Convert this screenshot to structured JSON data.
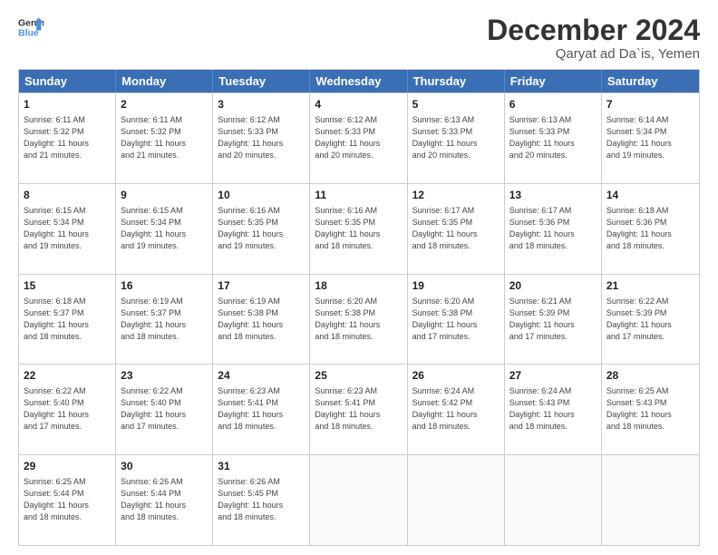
{
  "logo": {
    "line1": "General",
    "line2": "Blue"
  },
  "title": "December 2024",
  "location": "Qaryat ad Da`is, Yemen",
  "days_of_week": [
    "Sunday",
    "Monday",
    "Tuesday",
    "Wednesday",
    "Thursday",
    "Friday",
    "Saturday"
  ],
  "weeks": [
    [
      {
        "day": "1",
        "lines": [
          "Sunrise: 6:11 AM",
          "Sunset: 5:32 PM",
          "Daylight: 11 hours",
          "and 21 minutes."
        ]
      },
      {
        "day": "2",
        "lines": [
          "Sunrise: 6:11 AM",
          "Sunset: 5:32 PM",
          "Daylight: 11 hours",
          "and 21 minutes."
        ]
      },
      {
        "day": "3",
        "lines": [
          "Sunrise: 6:12 AM",
          "Sunset: 5:33 PM",
          "Daylight: 11 hours",
          "and 20 minutes."
        ]
      },
      {
        "day": "4",
        "lines": [
          "Sunrise: 6:12 AM",
          "Sunset: 5:33 PM",
          "Daylight: 11 hours",
          "and 20 minutes."
        ]
      },
      {
        "day": "5",
        "lines": [
          "Sunrise: 6:13 AM",
          "Sunset: 5:33 PM",
          "Daylight: 11 hours",
          "and 20 minutes."
        ]
      },
      {
        "day": "6",
        "lines": [
          "Sunrise: 6:13 AM",
          "Sunset: 5:33 PM",
          "Daylight: 11 hours",
          "and 20 minutes."
        ]
      },
      {
        "day": "7",
        "lines": [
          "Sunrise: 6:14 AM",
          "Sunset: 5:34 PM",
          "Daylight: 11 hours",
          "and 19 minutes."
        ]
      }
    ],
    [
      {
        "day": "8",
        "lines": [
          "Sunrise: 6:15 AM",
          "Sunset: 5:34 PM",
          "Daylight: 11 hours",
          "and 19 minutes."
        ]
      },
      {
        "day": "9",
        "lines": [
          "Sunrise: 6:15 AM",
          "Sunset: 5:34 PM",
          "Daylight: 11 hours",
          "and 19 minutes."
        ]
      },
      {
        "day": "10",
        "lines": [
          "Sunrise: 6:16 AM",
          "Sunset: 5:35 PM",
          "Daylight: 11 hours",
          "and 19 minutes."
        ]
      },
      {
        "day": "11",
        "lines": [
          "Sunrise: 6:16 AM",
          "Sunset: 5:35 PM",
          "Daylight: 11 hours",
          "and 18 minutes."
        ]
      },
      {
        "day": "12",
        "lines": [
          "Sunrise: 6:17 AM",
          "Sunset: 5:35 PM",
          "Daylight: 11 hours",
          "and 18 minutes."
        ]
      },
      {
        "day": "13",
        "lines": [
          "Sunrise: 6:17 AM",
          "Sunset: 5:36 PM",
          "Daylight: 11 hours",
          "and 18 minutes."
        ]
      },
      {
        "day": "14",
        "lines": [
          "Sunrise: 6:18 AM",
          "Sunset: 5:36 PM",
          "Daylight: 11 hours",
          "and 18 minutes."
        ]
      }
    ],
    [
      {
        "day": "15",
        "lines": [
          "Sunrise: 6:18 AM",
          "Sunset: 5:37 PM",
          "Daylight: 11 hours",
          "and 18 minutes."
        ]
      },
      {
        "day": "16",
        "lines": [
          "Sunrise: 6:19 AM",
          "Sunset: 5:37 PM",
          "Daylight: 11 hours",
          "and 18 minutes."
        ]
      },
      {
        "day": "17",
        "lines": [
          "Sunrise: 6:19 AM",
          "Sunset: 5:38 PM",
          "Daylight: 11 hours",
          "and 18 minutes."
        ]
      },
      {
        "day": "18",
        "lines": [
          "Sunrise: 6:20 AM",
          "Sunset: 5:38 PM",
          "Daylight: 11 hours",
          "and 18 minutes."
        ]
      },
      {
        "day": "19",
        "lines": [
          "Sunrise: 6:20 AM",
          "Sunset: 5:38 PM",
          "Daylight: 11 hours",
          "and 17 minutes."
        ]
      },
      {
        "day": "20",
        "lines": [
          "Sunrise: 6:21 AM",
          "Sunset: 5:39 PM",
          "Daylight: 11 hours",
          "and 17 minutes."
        ]
      },
      {
        "day": "21",
        "lines": [
          "Sunrise: 6:22 AM",
          "Sunset: 5:39 PM",
          "Daylight: 11 hours",
          "and 17 minutes."
        ]
      }
    ],
    [
      {
        "day": "22",
        "lines": [
          "Sunrise: 6:22 AM",
          "Sunset: 5:40 PM",
          "Daylight: 11 hours",
          "and 17 minutes."
        ]
      },
      {
        "day": "23",
        "lines": [
          "Sunrise: 6:22 AM",
          "Sunset: 5:40 PM",
          "Daylight: 11 hours",
          "and 17 minutes."
        ]
      },
      {
        "day": "24",
        "lines": [
          "Sunrise: 6:23 AM",
          "Sunset: 5:41 PM",
          "Daylight: 11 hours",
          "and 18 minutes."
        ]
      },
      {
        "day": "25",
        "lines": [
          "Sunrise: 6:23 AM",
          "Sunset: 5:41 PM",
          "Daylight: 11 hours",
          "and 18 minutes."
        ]
      },
      {
        "day": "26",
        "lines": [
          "Sunrise: 6:24 AM",
          "Sunset: 5:42 PM",
          "Daylight: 11 hours",
          "and 18 minutes."
        ]
      },
      {
        "day": "27",
        "lines": [
          "Sunrise: 6:24 AM",
          "Sunset: 5:43 PM",
          "Daylight: 11 hours",
          "and 18 minutes."
        ]
      },
      {
        "day": "28",
        "lines": [
          "Sunrise: 6:25 AM",
          "Sunset: 5:43 PM",
          "Daylight: 11 hours",
          "and 18 minutes."
        ]
      }
    ],
    [
      {
        "day": "29",
        "lines": [
          "Sunrise: 6:25 AM",
          "Sunset: 5:44 PM",
          "Daylight: 11 hours",
          "and 18 minutes."
        ]
      },
      {
        "day": "30",
        "lines": [
          "Sunrise: 6:26 AM",
          "Sunset: 5:44 PM",
          "Daylight: 11 hours",
          "and 18 minutes."
        ]
      },
      {
        "day": "31",
        "lines": [
          "Sunrise: 6:26 AM",
          "Sunset: 5:45 PM",
          "Daylight: 11 hours",
          "and 18 minutes."
        ]
      },
      {
        "day": "",
        "lines": []
      },
      {
        "day": "",
        "lines": []
      },
      {
        "day": "",
        "lines": []
      },
      {
        "day": "",
        "lines": []
      }
    ]
  ]
}
